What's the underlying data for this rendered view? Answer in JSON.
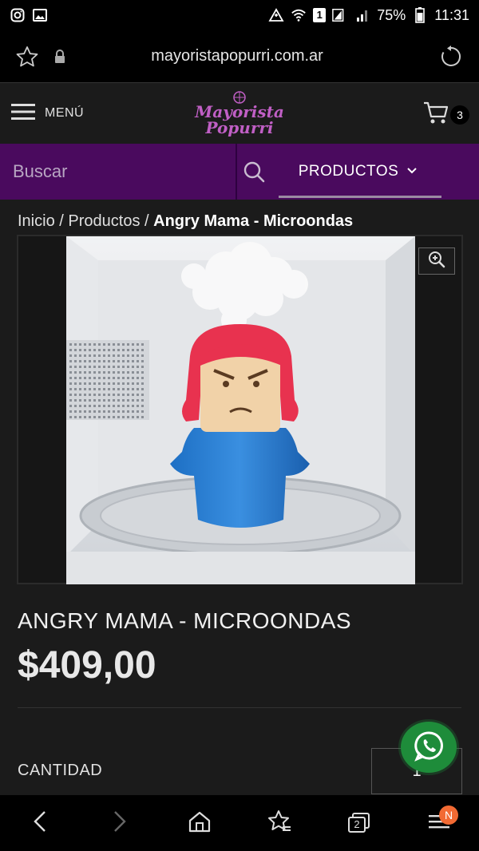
{
  "status_bar": {
    "battery": "75%",
    "time": "11:31",
    "sim_slot": "1"
  },
  "browser": {
    "url": "mayoristapopurri.com.ar"
  },
  "header": {
    "menu_label": "MENÚ",
    "logo_line1": "Mayorista",
    "logo_line2": "Popurri",
    "cart_count": "3"
  },
  "nav": {
    "search_placeholder": "Buscar",
    "products_label": "PRODUCTOS"
  },
  "breadcrumb": {
    "home": "Inicio",
    "separator": "/",
    "products": "Productos",
    "current": "Angry Mama - Microondas"
  },
  "product": {
    "title": "ANGRY MAMA - MICROONDAS",
    "price": "$409,00",
    "quantity_label": "CANTIDAD",
    "quantity_value": "1"
  },
  "bottom_nav": {
    "tabs_count": "2",
    "notification_badge": "N"
  },
  "colors": {
    "purple_bar": "#4a0a5e",
    "logo_purple": "#c05fc5",
    "whatsapp_green": "#1e8c3a",
    "badge_orange": "#f26a33"
  }
}
